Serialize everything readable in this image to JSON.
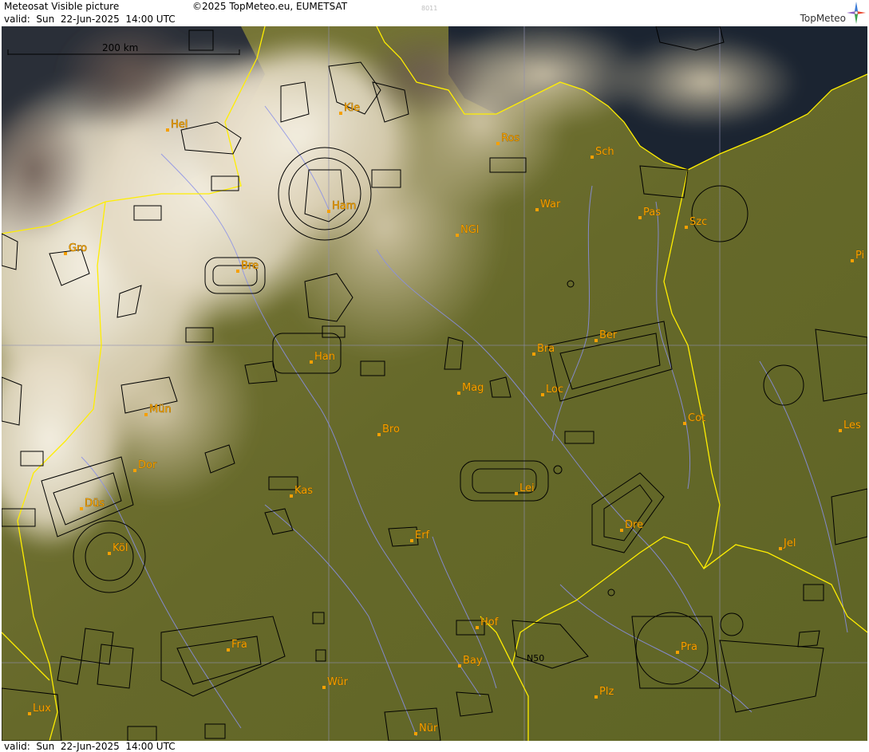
{
  "header": {
    "title": "Meteosat Visible picture",
    "valid": "valid:  Sun  22-Jun-2025  14:00 UTC",
    "copyright": "©2025 TopMeteo.eu, EUMETSAT",
    "image_code": "8011",
    "brand": "TopMeteo"
  },
  "footer": {
    "valid": "valid:  Sun  22-Jun-2025  14:00 UTC"
  },
  "scale": {
    "label": "200 km"
  },
  "grid": {
    "lat_label": "N50"
  },
  "colors": {
    "land": "#6b6a2a",
    "sea": "#1a2533",
    "cloud": "#e8e2cf",
    "border": "#ffee00",
    "river": "#8a8fe8",
    "city": "#f5a000",
    "grid": "#8f8fb0"
  },
  "cities": [
    {
      "name": "Hel"
    },
    {
      "name": "Kie"
    },
    {
      "name": "Ros"
    },
    {
      "name": "Sch"
    },
    {
      "name": "Ham"
    },
    {
      "name": "War"
    },
    {
      "name": "Pas"
    },
    {
      "name": "Szc"
    },
    {
      "name": "NGl"
    },
    {
      "name": "Gro"
    },
    {
      "name": "Bre"
    },
    {
      "name": "Pi"
    },
    {
      "name": "Han"
    },
    {
      "name": "Bra"
    },
    {
      "name": "Ber"
    },
    {
      "name": "Mag"
    },
    {
      "name": "Loc"
    },
    {
      "name": "Mün"
    },
    {
      "name": "Cot"
    },
    {
      "name": "Les"
    },
    {
      "name": "Bro"
    },
    {
      "name": "Dor"
    },
    {
      "name": "Kas"
    },
    {
      "name": "Lei"
    },
    {
      "name": "Düs"
    },
    {
      "name": "Dre"
    },
    {
      "name": "Erf"
    },
    {
      "name": "Jel"
    },
    {
      "name": "Köl"
    },
    {
      "name": "Hof"
    },
    {
      "name": "Fra"
    },
    {
      "name": "Pra"
    },
    {
      "name": "Bay"
    },
    {
      "name": "Wür"
    },
    {
      "name": "Plz"
    },
    {
      "name": "Lux"
    },
    {
      "name": "Nür"
    }
  ]
}
